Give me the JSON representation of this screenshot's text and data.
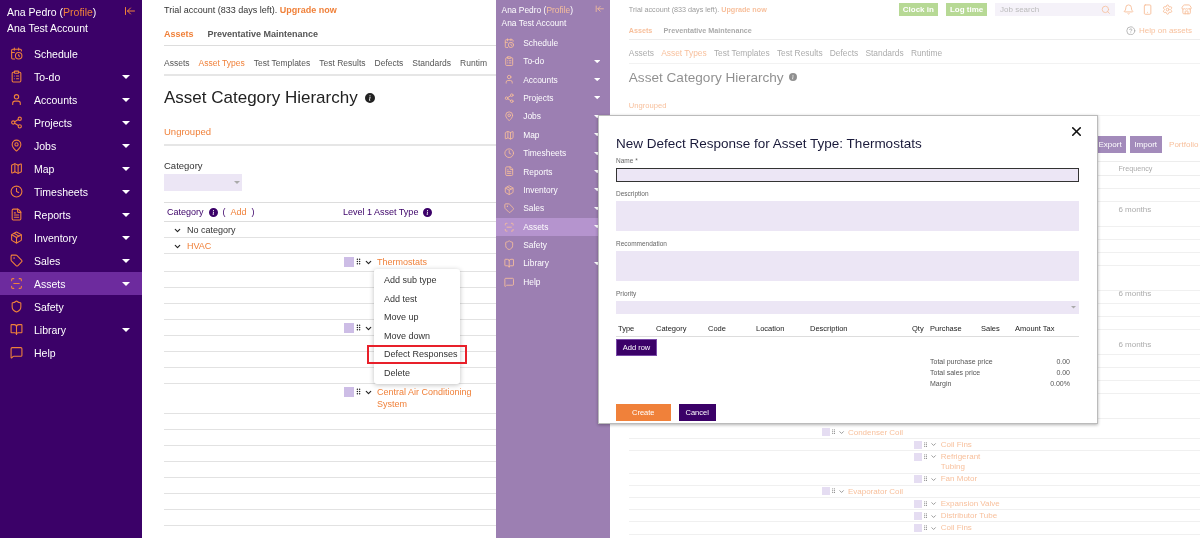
{
  "left_view": {
    "sidebar": {
      "user": "Ana Pedro",
      "profile_open": "(",
      "profile_link": "Profile",
      "profile_close": ")",
      "account": "Ana Test Account",
      "items": [
        {
          "label": "Schedule",
          "expandable": false,
          "selected": false
        },
        {
          "label": "To-do",
          "expandable": true,
          "selected": false
        },
        {
          "label": "Accounts",
          "expandable": true,
          "selected": false
        },
        {
          "label": "Projects",
          "expandable": true,
          "selected": false
        },
        {
          "label": "Jobs",
          "expandable": true,
          "selected": false
        },
        {
          "label": "Map",
          "expandable": true,
          "selected": false
        },
        {
          "label": "Timesheets",
          "expandable": true,
          "selected": false
        },
        {
          "label": "Reports",
          "expandable": true,
          "selected": false
        },
        {
          "label": "Inventory",
          "expandable": true,
          "selected": false
        },
        {
          "label": "Sales",
          "expandable": true,
          "selected": false
        },
        {
          "label": "Assets",
          "expandable": true,
          "selected": true
        },
        {
          "label": "Safety",
          "expandable": false,
          "selected": false
        },
        {
          "label": "Library",
          "expandable": true,
          "selected": false
        },
        {
          "label": "Help",
          "expandable": false,
          "selected": false
        }
      ]
    },
    "trial": {
      "text": "Trial account (833 days left).",
      "link": "Upgrade now"
    },
    "module_tabs": [
      {
        "label": "Assets",
        "selected": true
      },
      {
        "label": "Preventative Maintenance",
        "selected": false
      }
    ],
    "sub_tabs": [
      {
        "label": "Assets",
        "selected": false
      },
      {
        "label": "Asset Types",
        "selected": true
      },
      {
        "label": "Test Templates",
        "selected": false
      },
      {
        "label": "Test Results",
        "selected": false
      },
      {
        "label": "Defects",
        "selected": false
      },
      {
        "label": "Standards",
        "selected": false
      },
      {
        "label": "Runtim",
        "selected": false
      }
    ],
    "title": "Asset Category Hierarchy",
    "group_link": "Ungrouped",
    "category_filter": {
      "label": "Category"
    },
    "table": {
      "category_header": "Category",
      "add_open": "(",
      "add_link": "Add",
      "add_close": ")",
      "level1_header": "Level 1 Asset Type",
      "tree": [
        {
          "label": "No category",
          "expanded": true
        },
        {
          "label": "HVAC",
          "expanded": true,
          "children": [
            {
              "label": "Thermostats",
              "expanded": true,
              "menu": [
                {
                  "label": "Add sub type",
                  "highlighted": false
                },
                {
                  "label": "Add test",
                  "highlighted": false
                },
                {
                  "label": "Move up",
                  "highlighted": false
                },
                {
                  "label": "Move down",
                  "highlighted": false
                },
                {
                  "label": "Defect Responses",
                  "highlighted": true
                },
                {
                  "label": "Delete",
                  "highlighted": false
                }
              ]
            },
            {
              "expanded": true
            },
            {
              "label": "Central Air Conditioning System",
              "expanded": true
            }
          ]
        }
      ]
    }
  },
  "right_view": {
    "sidebar": {
      "user": "Ana Pedro",
      "profile_open": "(",
      "profile_link": "Profile",
      "profile_close": ")",
      "account": "Ana Test Account",
      "items": [
        {
          "label": "Schedule",
          "expandable": false,
          "selected": false
        },
        {
          "label": "To-do",
          "expandable": true,
          "selected": false
        },
        {
          "label": "Accounts",
          "expandable": true,
          "selected": false
        },
        {
          "label": "Projects",
          "expandable": true,
          "selected": false
        },
        {
          "label": "Jobs",
          "expandable": true,
          "selected": false
        },
        {
          "label": "Map",
          "expandable": true,
          "selected": false
        },
        {
          "label": "Timesheets",
          "expandable": true,
          "selected": false
        },
        {
          "label": "Reports",
          "expandable": true,
          "selected": false
        },
        {
          "label": "Inventory",
          "expandable": true,
          "selected": false
        },
        {
          "label": "Sales",
          "expandable": true,
          "selected": false
        },
        {
          "label": "Assets",
          "expandable": true,
          "selected": true
        },
        {
          "label": "Safety",
          "expandable": false,
          "selected": false
        },
        {
          "label": "Library",
          "expandable": true,
          "selected": false
        },
        {
          "label": "Help",
          "expandable": false,
          "selected": false
        }
      ]
    },
    "trial": {
      "text": "Trial account (833 days left).",
      "link": "Upgrade now"
    },
    "toolbar": {
      "buttons": [
        "Clock in",
        "Log time"
      ],
      "search": {
        "placeholder": "Job search"
      },
      "help_link": "Help on assets"
    },
    "module_tabs": [
      {
        "label": "Assets",
        "selected": true
      },
      {
        "label": "Preventative Maintenance",
        "selected": false
      }
    ],
    "sub_tabs": [
      {
        "label": "Assets",
        "selected": false
      },
      {
        "label": "Asset Types",
        "selected": true
      },
      {
        "label": "Test Templates",
        "selected": false
      },
      {
        "label": "Test Results",
        "selected": false
      },
      {
        "label": "Defects",
        "selected": false
      },
      {
        "label": "Standards",
        "selected": false
      },
      {
        "label": "Runtime",
        "selected": false
      }
    ],
    "title": "Asset Category Hierarchy",
    "group_link": "Ungrouped",
    "actions": {
      "buttons": [
        "Export",
        "Import"
      ],
      "link": "Portfolio"
    },
    "table": {
      "frequency_header": "Frequency",
      "frequency_values": [
        "6 months",
        "6 months",
        "6 months"
      ],
      "tree": [
        {
          "label": "Condenser Coil",
          "expanded": true,
          "children": [
            {
              "label": "Coil Fins",
              "expanded": true
            },
            {
              "label": "Refrigerant Tubing",
              "expanded": true
            },
            {
              "label": "Fan Motor",
              "expanded": true
            }
          ]
        },
        {
          "label": "Evaporator Coil",
          "expanded": true,
          "children": [
            {
              "label": "Expansion Valve",
              "expanded": true
            },
            {
              "label": "Distributor Tube",
              "expanded": true
            },
            {
              "label": "Coil Fins",
              "expanded": true
            }
          ]
        }
      ]
    }
  },
  "modal": {
    "title": "New Defect Response for Asset Type: Thermostats",
    "fields": [
      {
        "kind": "input",
        "label": "Name *",
        "focused": true
      },
      {
        "kind": "textarea",
        "label": "Description",
        "focused": false
      },
      {
        "kind": "textarea",
        "label": "Recommendation",
        "focused": false
      },
      {
        "kind": "select",
        "label": "Priority",
        "focused": false
      }
    ],
    "columns": [
      "Type",
      "Category",
      "Code",
      "Location",
      "Description",
      "Qty",
      "Purchase",
      "Sales",
      "Amount Tax"
    ],
    "add_row": "Add row",
    "totals": [
      {
        "label": "Total purchase price",
        "value": "0.00"
      },
      {
        "label": "Total sales price",
        "value": "0.00"
      },
      {
        "label": "Margin",
        "value": "0.00%"
      }
    ],
    "buttons": [
      {
        "label": "Create",
        "kind": "primary"
      },
      {
        "label": "Cancel",
        "kind": "secondary"
      }
    ]
  }
}
